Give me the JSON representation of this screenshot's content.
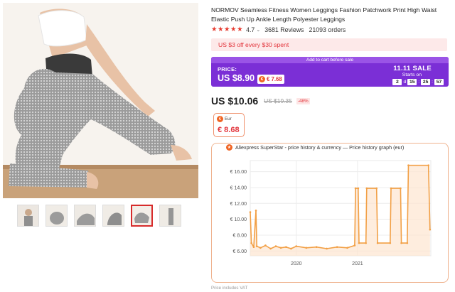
{
  "product": {
    "title": "NORMOV Seamless Fitness Women Leggings Fashion Patchwork Print High Waist Elastic Push Up Ankle Length Polyester Leggings",
    "stars": "★★★★★",
    "rating": "4.7",
    "reviews": "3681 Reviews",
    "orders": "21093 orders"
  },
  "gallery": {
    "thumbnails": [
      "thumbnail-1",
      "thumbnail-2",
      "thumbnail-3",
      "thumbnail-4",
      "thumbnail-5",
      "thumbnail-6"
    ],
    "active_index": 4
  },
  "coupon": {
    "text": "US $3 off every $30 spent"
  },
  "sale": {
    "top_text": "Add to cart before sale",
    "price_label": "PRICE:",
    "price": "US $8.90",
    "eur_price": "€ 7.68",
    "brand": "11.11 SALE",
    "starts_on": "Starts on",
    "countdown": {
      "days": "2",
      "days_unit": "d",
      "hours": "15",
      "minutes": "25",
      "seconds": "57"
    }
  },
  "price": {
    "current": "US $10.06",
    "original": "US $19.35",
    "discount": "-48%"
  },
  "eur_box": {
    "label": "Eur",
    "value": "€ 8.68"
  },
  "chart_title": "Aliexpress SuperStar - price history & currency — Price history graph (eur)",
  "footnote": "Price includes VAT",
  "colors": {
    "accent": "#e2343b",
    "sale_purple": "#7b2fd6",
    "line": "#f2a046",
    "fill": "#fde6d0"
  },
  "chart_data": {
    "type": "line",
    "title": "Price history graph (eur)",
    "xlabel": "",
    "ylabel": "",
    "x_ticks": [
      "2020",
      "2021"
    ],
    "y_ticks": [
      "€ 6.00",
      "€ 8.00",
      "€ 10.00",
      "€ 12.00",
      "€ 14.00",
      "€ 16.00"
    ],
    "ylim": [
      5.4,
      17.4
    ],
    "xlim": [
      "2019-04-01",
      "2022-03-15"
    ],
    "grid": true,
    "series": [
      {
        "points": [
          [
            "2019-04-01",
            10.9
          ],
          [
            "2019-04-08",
            7.0
          ],
          [
            "2019-04-22",
            6.5
          ],
          [
            "2019-05-05",
            11.1
          ],
          [
            "2019-05-10",
            6.6
          ],
          [
            "2019-06-01",
            6.4
          ],
          [
            "2019-07-01",
            6.7
          ],
          [
            "2019-08-01",
            6.3
          ],
          [
            "2019-09-01",
            6.6
          ],
          [
            "2019-10-01",
            6.4
          ],
          [
            "2019-11-01",
            6.5
          ],
          [
            "2019-12-01",
            6.3
          ],
          [
            "2020-01-01",
            6.6
          ],
          [
            "2020-03-01",
            6.4
          ],
          [
            "2020-05-01",
            6.5
          ],
          [
            "2020-07-01",
            6.3
          ],
          [
            "2020-09-01",
            6.5
          ],
          [
            "2020-11-01",
            6.4
          ],
          [
            "2020-12-15",
            6.7
          ],
          [
            "2020-12-20",
            13.9
          ],
          [
            "2021-01-05",
            13.9
          ],
          [
            "2021-01-10",
            7.0
          ],
          [
            "2021-02-20",
            7.0
          ],
          [
            "2021-02-25",
            13.9
          ],
          [
            "2021-04-25",
            13.9
          ],
          [
            "2021-05-01",
            7.0
          ],
          [
            "2021-07-15",
            7.0
          ],
          [
            "2021-07-20",
            13.9
          ],
          [
            "2021-09-15",
            13.9
          ],
          [
            "2021-09-20",
            7.0
          ],
          [
            "2021-10-25",
            7.0
          ],
          [
            "2021-11-01",
            16.8
          ],
          [
            "2022-03-01",
            16.8
          ],
          [
            "2022-03-10",
            8.7
          ]
        ]
      }
    ]
  }
}
